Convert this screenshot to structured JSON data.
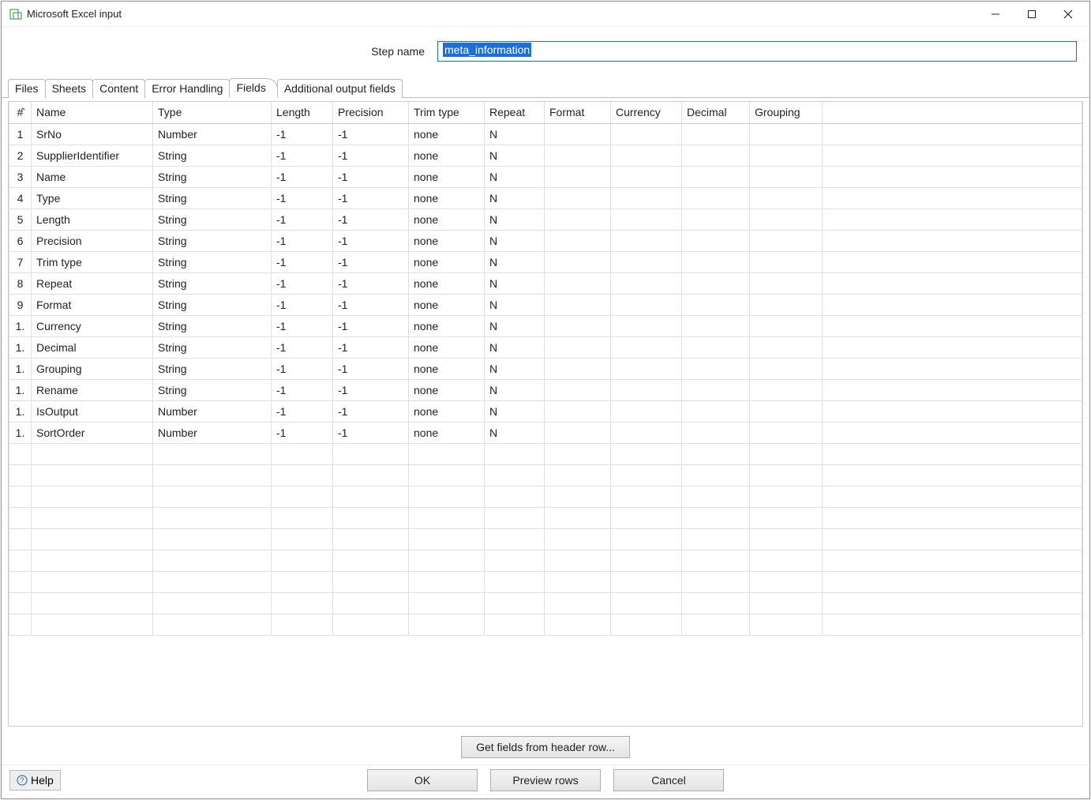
{
  "window": {
    "title": "Microsoft Excel input"
  },
  "stepname": {
    "label": "Step name",
    "value": "meta_information"
  },
  "tabs": [
    {
      "label": "Files"
    },
    {
      "label": "Sheets"
    },
    {
      "label": "Content"
    },
    {
      "label": "Error Handling"
    },
    {
      "label": "Fields",
      "active": true
    },
    {
      "label": "Additional output fields"
    }
  ],
  "columns": {
    "num": "#̂",
    "name": "Name",
    "type": "Type",
    "length": "Length",
    "precision": "Precision",
    "trim": "Trim type",
    "repeat": "Repeat",
    "format": "Format",
    "currency": "Currency",
    "decimal": "Decimal",
    "grouping": "Grouping"
  },
  "rows": [
    {
      "num": "1",
      "name": "SrNo",
      "type": "Number",
      "length": "-1",
      "precision": "-1",
      "trim": "none",
      "repeat": "N",
      "format": "",
      "currency": "",
      "decimal": "",
      "grouping": ""
    },
    {
      "num": "2",
      "name": "SupplierIdentifier",
      "type": "String",
      "length": "-1",
      "precision": "-1",
      "trim": "none",
      "repeat": "N",
      "format": "",
      "currency": "",
      "decimal": "",
      "grouping": ""
    },
    {
      "num": "3",
      "name": "Name",
      "type": "String",
      "length": "-1",
      "precision": "-1",
      "trim": "none",
      "repeat": "N",
      "format": "",
      "currency": "",
      "decimal": "",
      "grouping": ""
    },
    {
      "num": "4",
      "name": "Type",
      "type": "String",
      "length": "-1",
      "precision": "-1",
      "trim": "none",
      "repeat": "N",
      "format": "",
      "currency": "",
      "decimal": "",
      "grouping": ""
    },
    {
      "num": "5",
      "name": "Length",
      "type": "String",
      "length": "-1",
      "precision": "-1",
      "trim": "none",
      "repeat": "N",
      "format": "",
      "currency": "",
      "decimal": "",
      "grouping": ""
    },
    {
      "num": "6",
      "name": "Precision",
      "type": "String",
      "length": "-1",
      "precision": "-1",
      "trim": "none",
      "repeat": "N",
      "format": "",
      "currency": "",
      "decimal": "",
      "grouping": ""
    },
    {
      "num": "7",
      "name": "Trim type",
      "type": "String",
      "length": "-1",
      "precision": "-1",
      "trim": "none",
      "repeat": "N",
      "format": "",
      "currency": "",
      "decimal": "",
      "grouping": ""
    },
    {
      "num": "8",
      "name": "Repeat",
      "type": "String",
      "length": "-1",
      "precision": "-1",
      "trim": "none",
      "repeat": "N",
      "format": "",
      "currency": "",
      "decimal": "",
      "grouping": ""
    },
    {
      "num": "9",
      "name": "Format",
      "type": "String",
      "length": "-1",
      "precision": "-1",
      "trim": "none",
      "repeat": "N",
      "format": "",
      "currency": "",
      "decimal": "",
      "grouping": ""
    },
    {
      "num": "1.",
      "name": "Currency",
      "type": "String",
      "length": "-1",
      "precision": "-1",
      "trim": "none",
      "repeat": "N",
      "format": "",
      "currency": "",
      "decimal": "",
      "grouping": ""
    },
    {
      "num": "1.",
      "name": "Decimal",
      "type": "String",
      "length": "-1",
      "precision": "-1",
      "trim": "none",
      "repeat": "N",
      "format": "",
      "currency": "",
      "decimal": "",
      "grouping": ""
    },
    {
      "num": "1.",
      "name": "Grouping",
      "type": "String",
      "length": "-1",
      "precision": "-1",
      "trim": "none",
      "repeat": "N",
      "format": "",
      "currency": "",
      "decimal": "",
      "grouping": ""
    },
    {
      "num": "1.",
      "name": "Rename",
      "type": "String",
      "length": "-1",
      "precision": "-1",
      "trim": "none",
      "repeat": "N",
      "format": "",
      "currency": "",
      "decimal": "",
      "grouping": ""
    },
    {
      "num": "1.",
      "name": "IsOutput",
      "type": "Number",
      "length": "-1",
      "precision": "-1",
      "trim": "none",
      "repeat": "N",
      "format": "",
      "currency": "",
      "decimal": "",
      "grouping": ""
    },
    {
      "num": "1.",
      "name": "SortOrder",
      "type": "Number",
      "length": "-1",
      "precision": "-1",
      "trim": "none",
      "repeat": "N",
      "format": "",
      "currency": "",
      "decimal": "",
      "grouping": ""
    }
  ],
  "emptyRows": 9,
  "buttons": {
    "getFields": "Get fields from header row...",
    "help": "Help",
    "ok": "OK",
    "preview": "Preview rows",
    "cancel": "Cancel"
  }
}
